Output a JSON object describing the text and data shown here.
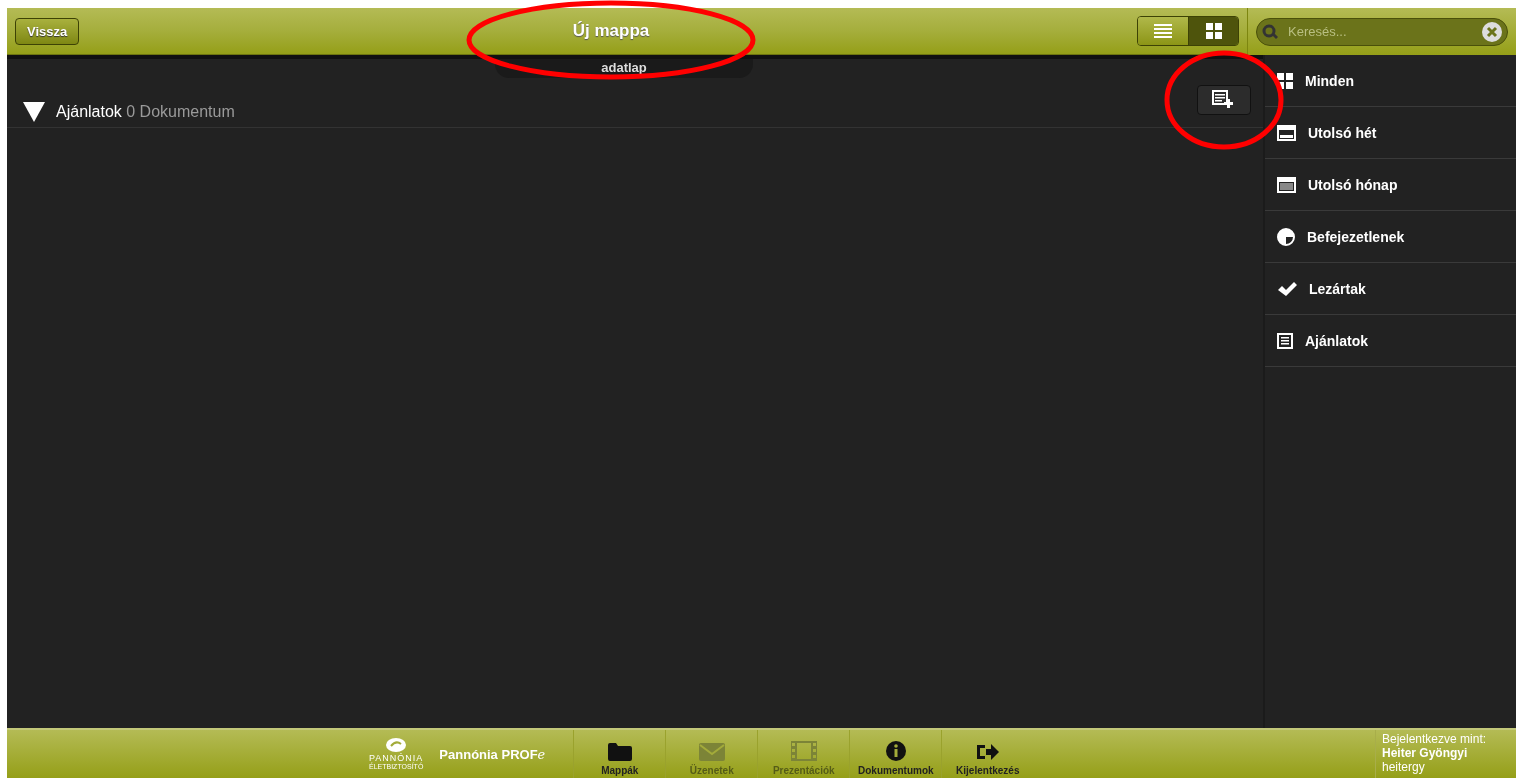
{
  "header": {
    "back_button": "Vissza",
    "title": "Új mappa",
    "title_circled": true,
    "subtitle_tab": "adatlap",
    "view_toggle": [
      {
        "kind": "list",
        "selected": false
      },
      {
        "kind": "grid",
        "selected": true
      }
    ]
  },
  "search": {
    "placeholder": "Keresés..."
  },
  "section": {
    "title": "Ajánlatok",
    "count": "0 Dokumentum",
    "expanded": true
  },
  "add_button": {
    "circled": true
  },
  "sidebar": {
    "items": [
      {
        "kind": "grid",
        "label": "Minden"
      },
      {
        "kind": "week",
        "label": "Utolsó hét"
      },
      {
        "kind": "month",
        "label": "Utolsó hónap"
      },
      {
        "kind": "half",
        "label": "Befejezetlenek"
      },
      {
        "kind": "check",
        "label": "Lezártak"
      },
      {
        "kind": "doc",
        "label": "Ajánlatok"
      }
    ]
  },
  "footer": {
    "logo_name": "PANNÓNIA",
    "logo_sub": "ÉLETBIZTOSÍTÓ",
    "brand": "Pannónia PROF",
    "brand_suffix": "e",
    "nav": [
      {
        "kind": "folder",
        "label": "Mappák",
        "disabled": false
      },
      {
        "kind": "mail",
        "label": "Üzenetek",
        "disabled": true
      },
      {
        "kind": "film",
        "label": "Prezentációk",
        "disabled": true
      },
      {
        "kind": "info",
        "label": "Dokumentumok",
        "disabled": false
      },
      {
        "kind": "logout",
        "label": "Kijelentkezés",
        "disabled": false
      }
    ],
    "login": {
      "caption": "Bejelentkezve mint:",
      "name": "Heiter Gyöngyi",
      "user": "heitergy"
    }
  }
}
